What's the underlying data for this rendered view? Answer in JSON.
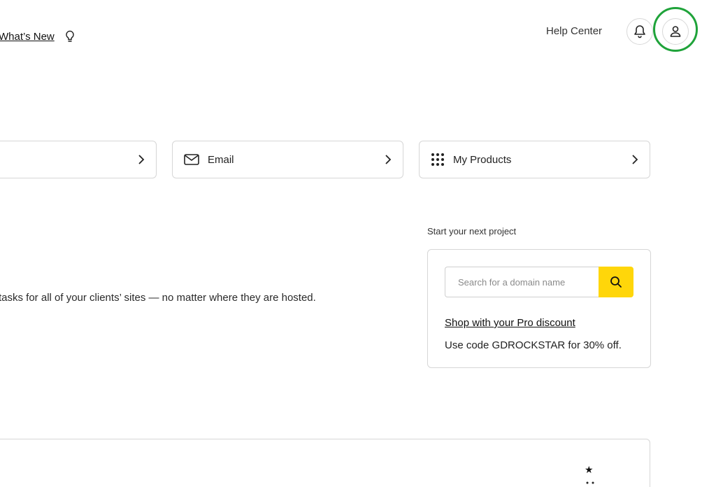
{
  "header": {
    "whats_new_label": "What’s New",
    "help_center_label": "Help Center"
  },
  "quick_links": [
    {
      "label": "",
      "icon": "none"
    },
    {
      "label": "Email",
      "icon": "envelope-icon"
    },
    {
      "label": "My Products",
      "icon": "grid-dots-icon"
    }
  ],
  "main": {
    "tools_text": "tasks for all of your clients’ sites — no matter where they are hosted."
  },
  "project": {
    "heading": "Start your next project",
    "search_placeholder": "Search for a domain name",
    "discount_link": "Shop with your Pro discount",
    "discount_code_text": "Use code GDROCKSTAR for 30% off."
  },
  "colors": {
    "accent_yellow": "#ffd60a",
    "highlight_green": "#1fa33a",
    "border": "#d6d6d6"
  }
}
